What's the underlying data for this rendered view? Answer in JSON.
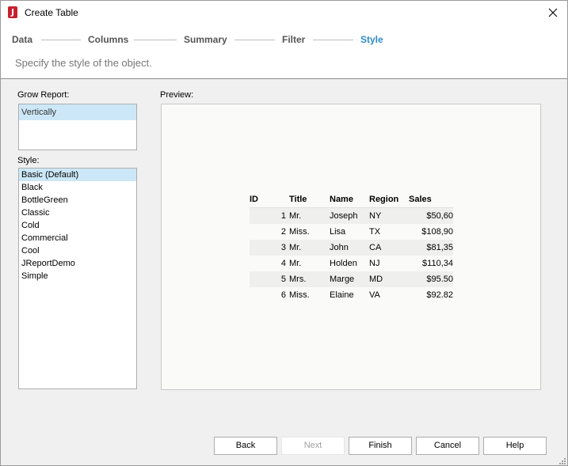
{
  "window": {
    "title": "Create Table"
  },
  "wizard": {
    "steps": [
      {
        "label": "Data"
      },
      {
        "label": "Columns"
      },
      {
        "label": "Summary"
      },
      {
        "label": "Filter"
      },
      {
        "label": "Style"
      }
    ],
    "active_step": "Style",
    "subtitle": "Specify the style of the object."
  },
  "grow_report": {
    "label": "Grow Report:",
    "items": [
      "Vertically"
    ],
    "selected": "Vertically"
  },
  "style": {
    "label": "Style:",
    "items": [
      "Basic (Default)",
      "Black",
      "BottleGreen",
      "Classic",
      "Cold",
      "Commercial",
      "Cool",
      "JReportDemo",
      "Simple"
    ],
    "selected": "Basic (Default)"
  },
  "preview": {
    "label": "Preview:",
    "headers": [
      "ID",
      "Title",
      "Name",
      "Region",
      "Sales"
    ],
    "rows": [
      [
        "1",
        "Mr.",
        "Joseph",
        "NY",
        "$50,60"
      ],
      [
        "2",
        "Miss.",
        "Lisa",
        "TX",
        "$108,90"
      ],
      [
        "3",
        "Mr.",
        "John",
        "CA",
        "$81,35"
      ],
      [
        "4",
        "Mr.",
        "Holden",
        "NJ",
        "$110,34"
      ],
      [
        "5",
        "Mrs.",
        "Marge",
        "MD",
        "$95.50"
      ],
      [
        "6",
        "Miss.",
        "Elaine",
        "VA",
        "$92.82"
      ]
    ]
  },
  "buttons": {
    "back": "Back",
    "next": "Next",
    "finish": "Finish",
    "cancel": "Cancel",
    "help": "Help"
  },
  "colors": {
    "active_step": "#2e8bc8",
    "selection": "#cce8f8",
    "app_icon": "#c8202e"
  }
}
